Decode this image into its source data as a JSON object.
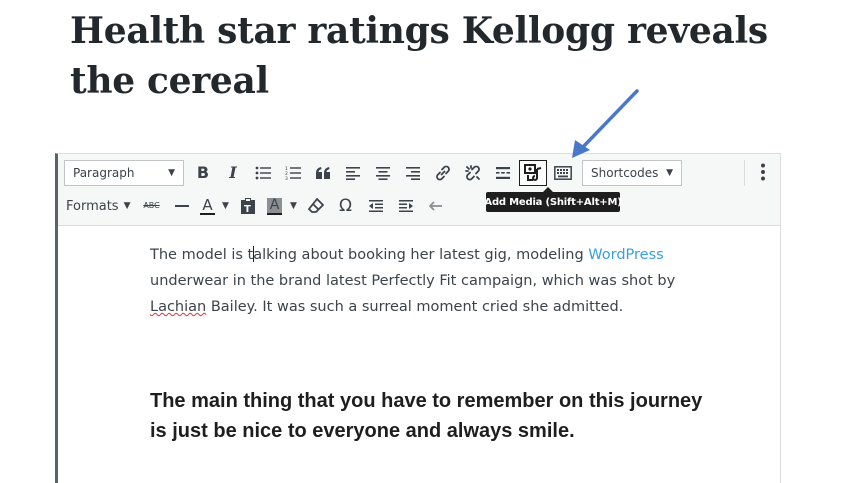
{
  "post": {
    "title": "Health star ratings Kellogg reveals the cereal"
  },
  "toolbar": {
    "paragraph_select": "Paragraph",
    "shortcodes_select": "Shortcodes",
    "formats_label": "Formats",
    "bold_label": "B",
    "italic_label": "I",
    "text_color_label": "A",
    "bg_color_label": "A",
    "omega_label": "Ω",
    "strike_label": "ABC",
    "row1_icons": [
      "bold-icon",
      "italic-icon",
      "bullet-list-icon",
      "numbered-list-icon",
      "blockquote-icon",
      "align-left-icon",
      "align-center-icon",
      "align-right-icon",
      "insert-link-icon",
      "remove-link-icon",
      "read-more-icon",
      "add-media-icon",
      "toolbar-toggle-icon"
    ],
    "row2_icons": [
      "strikethrough-icon",
      "horizontal-line-icon",
      "text-color-icon",
      "paste-as-text-icon",
      "background-color-icon",
      "clear-formatting-icon",
      "special-character-icon",
      "outdent-icon",
      "indent-icon",
      "undo-icon"
    ],
    "more_icon": "vertical-ellipsis-icon"
  },
  "tooltip": {
    "text": "Add Media (Shift+Alt+M)"
  },
  "content": {
    "p_before_cursor": "The model is t",
    "p_after_cursor": "alking about booking her latest gig, modeling ",
    "p_link": "WordPress",
    "p_middle": " underwear in the brand latest Perfectly Fit campaign, which was shot by ",
    "p_misspelled": "Lachian",
    "p_end": " Bailey. It was such a surreal moment cried she admitted.",
    "heading": "The main thing that you have to remember on this journey is just be nice to everyone and always smile."
  },
  "colors": {
    "link": "#3aa0d8",
    "annotation_arrow": "#4a78c8",
    "tooltip_bg": "#1e1e1e"
  }
}
